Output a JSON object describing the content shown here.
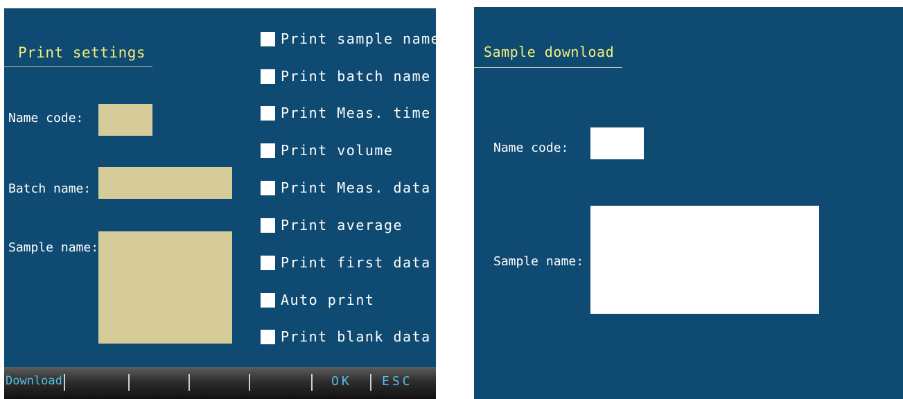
{
  "print_settings": {
    "title": "Print settings",
    "name_code_label": "Name code:",
    "batch_name_label": "Batch name:",
    "sample_name_label": "Sample name:",
    "options": [
      {
        "label": "Print sample name",
        "checked": false
      },
      {
        "label": "Print batch name",
        "checked": false
      },
      {
        "label": "Print Meas. time",
        "checked": false
      },
      {
        "label": "Print volume",
        "checked": false
      },
      {
        "label": "Print Meas. data",
        "checked": false
      },
      {
        "label": "Print average",
        "checked": false
      },
      {
        "label": "Print first data",
        "checked": false
      },
      {
        "label": "Auto print",
        "checked": false
      },
      {
        "label": "Print blank data",
        "checked": false
      }
    ],
    "footer": {
      "download_label": "Download",
      "ok_label": "OK",
      "esc_label": "ESC"
    }
  },
  "sample_download": {
    "title": "Sample download",
    "name_code_label": "Name code:",
    "sample_name_label": "Sample name:"
  },
  "colors": {
    "screen_background": "#0f4a72",
    "title_text": "#f2ee7a",
    "input_tan": "#d6cc9a",
    "input_white": "#ffffff",
    "footer_key_text": "#4fc0e8"
  }
}
